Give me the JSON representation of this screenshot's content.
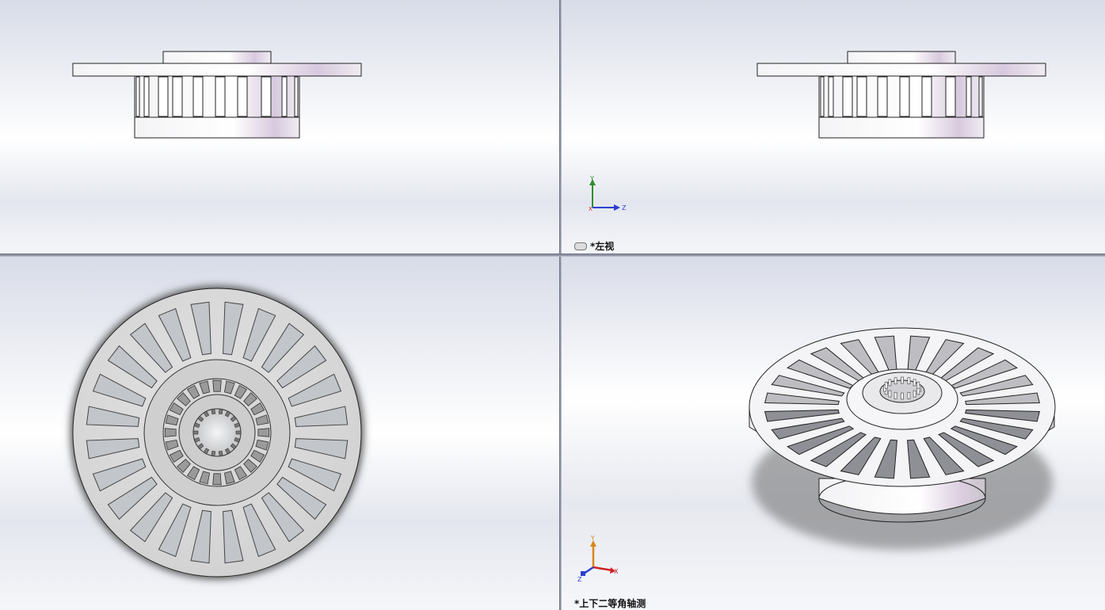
{
  "viewports": {
    "top_left": {
      "name": "front-view"
    },
    "top_right": {
      "name": "left-view",
      "label": "*左视"
    },
    "bottom_left": {
      "name": "top-view"
    },
    "bottom_right": {
      "name": "isometric-view",
      "label": "*上下二等角轴测"
    }
  },
  "triads": {
    "left_view": {
      "up": "Y",
      "right": "Z",
      "origin": "X"
    },
    "iso_view": {
      "up": "Y",
      "right": "X",
      "down": "Z"
    }
  },
  "colors": {
    "background_top": "#d7dbe6",
    "background_mid": "#ffffff",
    "part_face": "#e8e6ea",
    "part_edge": "#222222",
    "y_axis": "#2f8f2f",
    "z_axis": "#2b3fd1",
    "x_axis": "#cc2222",
    "iso_y_axis": "#d9861a"
  }
}
